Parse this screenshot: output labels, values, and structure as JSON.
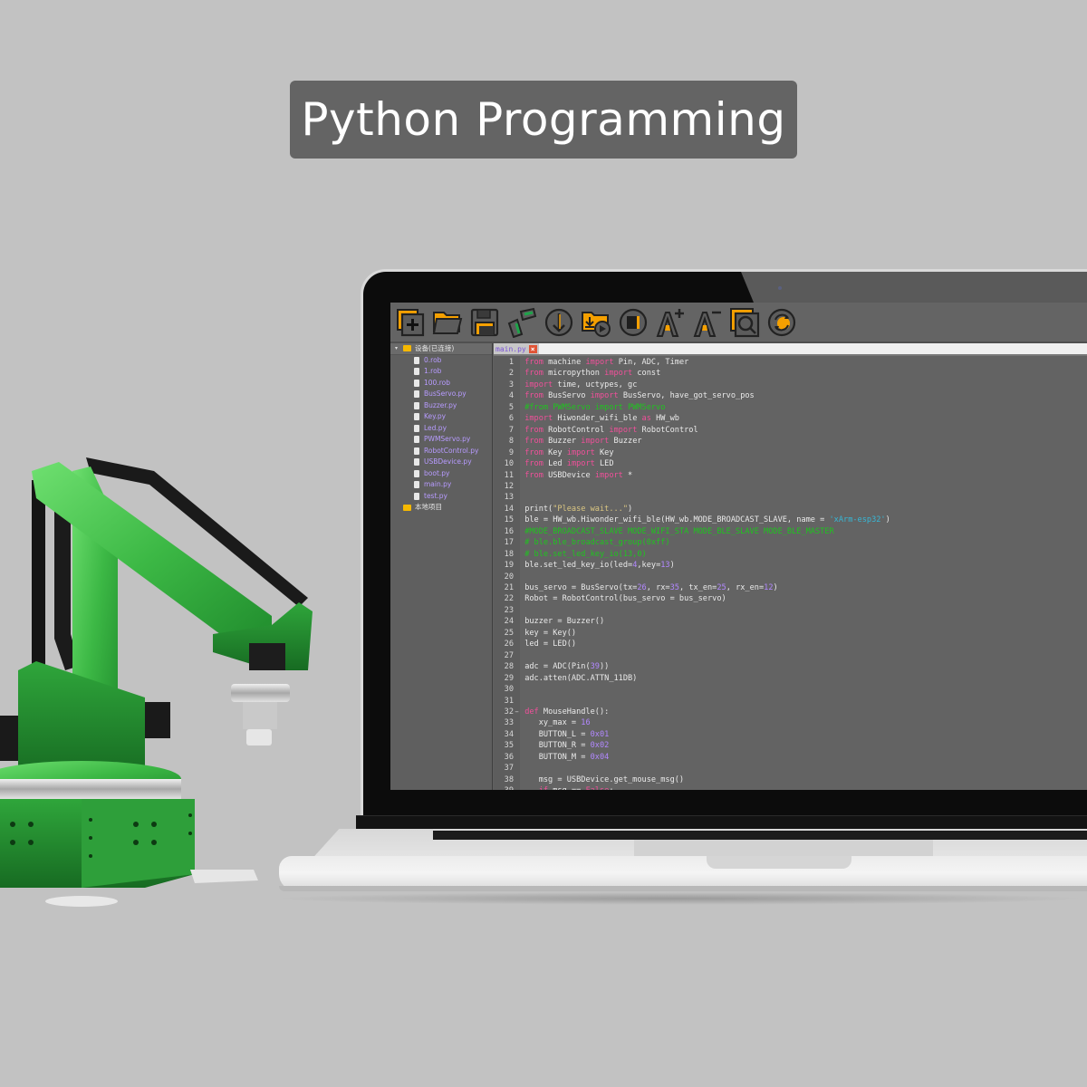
{
  "banner": {
    "title": "Python Programming"
  },
  "toolbar": {
    "buttons": [
      {
        "name": "new-file",
        "icon": "new-file-icon"
      },
      {
        "name": "open-folder",
        "icon": "folder-open-icon"
      },
      {
        "name": "save",
        "icon": "save-icon"
      },
      {
        "name": "connect",
        "icon": "link-icon"
      },
      {
        "name": "download",
        "icon": "download-icon"
      },
      {
        "name": "download-run",
        "icon": "download-run-icon"
      },
      {
        "name": "stop",
        "icon": "stop-icon"
      },
      {
        "name": "font-increase",
        "icon": "font-increase-icon"
      },
      {
        "name": "font-decrease",
        "icon": "font-decrease-icon"
      },
      {
        "name": "search",
        "icon": "search-icon"
      },
      {
        "name": "refresh",
        "icon": "refresh-icon"
      }
    ]
  },
  "file_tree": {
    "root_label": "设备(已连接)",
    "files": [
      "0.rob",
      "1.rob",
      "100.rob",
      "BusServo.py",
      "Buzzer.py",
      "Key.py",
      "Led.py",
      "PWMServo.py",
      "RobotControl.py",
      "USBDevice.py",
      "boot.py",
      "main.py",
      "test.py"
    ],
    "local_label": "本地项目"
  },
  "editor": {
    "active_tab": "main.py",
    "tab_close": "×",
    "lines": [
      [
        {
          "t": "kw",
          "v": "from"
        },
        {
          "t": "",
          "v": " machine "
        },
        {
          "t": "kw",
          "v": "import"
        },
        {
          "t": "",
          "v": " Pin, ADC, Timer"
        }
      ],
      [
        {
          "t": "kw",
          "v": "from"
        },
        {
          "t": "",
          "v": " micropython "
        },
        {
          "t": "kw",
          "v": "import"
        },
        {
          "t": "",
          "v": " const"
        }
      ],
      [
        {
          "t": "kw",
          "v": "import"
        },
        {
          "t": "",
          "v": " time, uctypes, gc"
        }
      ],
      [
        {
          "t": "kw",
          "v": "from"
        },
        {
          "t": "",
          "v": " BusServo "
        },
        {
          "t": "kw",
          "v": "import"
        },
        {
          "t": "",
          "v": " BusServo, have_got_servo_pos"
        }
      ],
      [
        {
          "t": "cm",
          "v": "#from PWMServo import PWMServo"
        }
      ],
      [
        {
          "t": "kw",
          "v": "import"
        },
        {
          "t": "",
          "v": " Hiwonder_wifi_ble "
        },
        {
          "t": "kw",
          "v": "as"
        },
        {
          "t": "",
          "v": " HW_wb"
        }
      ],
      [
        {
          "t": "kw",
          "v": "from"
        },
        {
          "t": "",
          "v": " RobotControl "
        },
        {
          "t": "kw",
          "v": "import"
        },
        {
          "t": "",
          "v": " RobotControl"
        }
      ],
      [
        {
          "t": "kw",
          "v": "from"
        },
        {
          "t": "",
          "v": " Buzzer "
        },
        {
          "t": "kw",
          "v": "import"
        },
        {
          "t": "",
          "v": " Buzzer"
        }
      ],
      [
        {
          "t": "kw",
          "v": "from"
        },
        {
          "t": "",
          "v": " Key "
        },
        {
          "t": "kw",
          "v": "import"
        },
        {
          "t": "",
          "v": " Key"
        }
      ],
      [
        {
          "t": "kw",
          "v": "from"
        },
        {
          "t": "",
          "v": " Led "
        },
        {
          "t": "kw",
          "v": "import"
        },
        {
          "t": "",
          "v": " LED"
        }
      ],
      [
        {
          "t": "kw",
          "v": "from"
        },
        {
          "t": "",
          "v": " USBDevice "
        },
        {
          "t": "kw",
          "v": "import"
        },
        {
          "t": "",
          "v": " *"
        }
      ],
      [],
      [],
      [
        {
          "t": "",
          "v": "print("
        },
        {
          "t": "str",
          "v": "\"Please wait...\""
        },
        {
          "t": "",
          "v": ")"
        }
      ],
      [
        {
          "t": "",
          "v": "ble = HW_wb.Hiwonder_wifi_ble(HW_wb.MODE_BROADCAST_SLAVE, name = "
        },
        {
          "t": "str2",
          "v": "'xArm-esp32'"
        },
        {
          "t": "",
          "v": ")"
        }
      ],
      [
        {
          "t": "cm",
          "v": "#MODE_BROADCAST_SLAVE MODE_WIFI_STA MODE_BLE_SLAVE MODE_BLE_MASTER"
        }
      ],
      [
        {
          "t": "cm",
          "v": "# ble.ble_broadcast_group(0xff)"
        }
      ],
      [
        {
          "t": "cm",
          "v": "# ble.set_led_key_io(13,0)"
        }
      ],
      [
        {
          "t": "",
          "v": "ble.set_led_key_io(led="
        },
        {
          "t": "num",
          "v": "4"
        },
        {
          "t": "",
          "v": ",key="
        },
        {
          "t": "num",
          "v": "13"
        },
        {
          "t": "",
          "v": ")"
        }
      ],
      [],
      [
        {
          "t": "",
          "v": "bus_servo = BusServo(tx="
        },
        {
          "t": "num",
          "v": "26"
        },
        {
          "t": "",
          "v": ", rx="
        },
        {
          "t": "num",
          "v": "35"
        },
        {
          "t": "",
          "v": ", tx_en="
        },
        {
          "t": "num",
          "v": "25"
        },
        {
          "t": "",
          "v": ", rx_en="
        },
        {
          "t": "num",
          "v": "12"
        },
        {
          "t": "",
          "v": ")"
        }
      ],
      [
        {
          "t": "",
          "v": "Robot = RobotControl(bus_servo = bus_servo)"
        }
      ],
      [],
      [
        {
          "t": "",
          "v": "buzzer = Buzzer()"
        }
      ],
      [
        {
          "t": "",
          "v": "key = Key()"
        }
      ],
      [
        {
          "t": "",
          "v": "led = LED()"
        }
      ],
      [],
      [
        {
          "t": "",
          "v": "adc = ADC(Pin("
        },
        {
          "t": "num",
          "v": "39"
        },
        {
          "t": "",
          "v": "))"
        }
      ],
      [
        {
          "t": "",
          "v": "adc.atten(ADC.ATTN_11DB)"
        }
      ],
      [],
      [],
      [
        {
          "t": "kw",
          "v": "def"
        },
        {
          "t": "",
          "v": " MouseHandle():"
        }
      ],
      [
        {
          "t": "",
          "v": "   xy_max = "
        },
        {
          "t": "num",
          "v": "16"
        }
      ],
      [
        {
          "t": "",
          "v": "   BUTTON_L = "
        },
        {
          "t": "num",
          "v": "0x01"
        }
      ],
      [
        {
          "t": "",
          "v": "   BUTTON_R = "
        },
        {
          "t": "num",
          "v": "0x02"
        }
      ],
      [
        {
          "t": "",
          "v": "   BUTTON_M = "
        },
        {
          "t": "num",
          "v": "0x04"
        }
      ],
      [],
      [
        {
          "t": "",
          "v": "   msg = USBDevice.get_mouse_msg()"
        }
      ],
      [
        {
          "t": "",
          "v": "   "
        },
        {
          "t": "kw",
          "v": "if"
        },
        {
          "t": "",
          "v": " msg == "
        },
        {
          "t": "kw",
          "v": "False"
        },
        {
          "t": "",
          "v": ":"
        }
      ]
    ],
    "fold_markers": {
      "32": "−",
      "39": "−"
    }
  },
  "colors": {
    "accent_orange": "#f5a000",
    "accent_green": "#1fa34a",
    "robot_green": "#3fbf4a"
  }
}
